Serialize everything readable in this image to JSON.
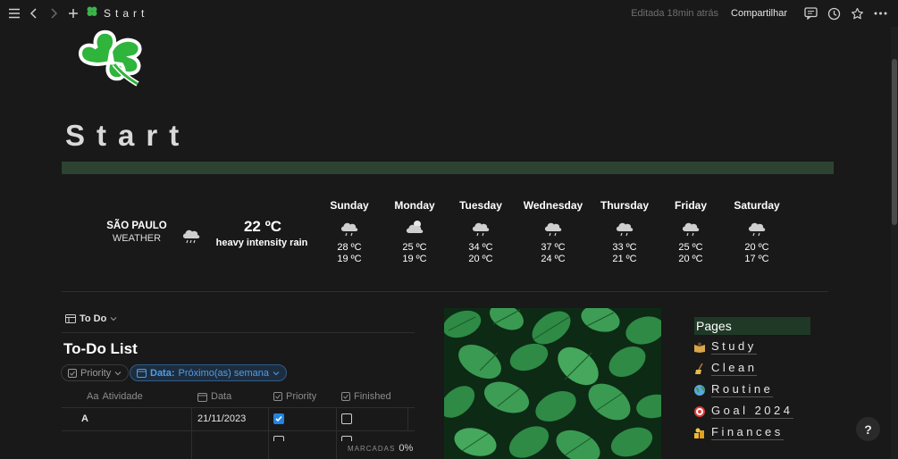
{
  "topbar": {
    "breadcrumb_title": "Start",
    "edited_text": "Editada 18min atrás",
    "share_label": "Compartilhar"
  },
  "page": {
    "title": "Start",
    "band_color": "#2c4331"
  },
  "weather": {
    "city": "SÃO PAULO",
    "subtitle": "WEATHER",
    "current_temp": "22 ºC",
    "current_desc": "heavy intensity rain",
    "current_icon": "rain-cloud-icon",
    "days": [
      {
        "name": "Sunday",
        "hi": "28 ºC",
        "lo": "19 ºC",
        "icon": "rain-cloud-icon"
      },
      {
        "name": "Monday",
        "hi": "25 ºC",
        "lo": "19 ºC",
        "icon": "sun-cloud-icon"
      },
      {
        "name": "Tuesday",
        "hi": "34 ºC",
        "lo": "20 ºC",
        "icon": "rain-cloud-icon"
      },
      {
        "name": "Wednesday",
        "hi": "37 ºC",
        "lo": "24 ºC",
        "icon": "rain-cloud-icon"
      },
      {
        "name": "Thursday",
        "hi": "33 ºC",
        "lo": "21 ºC",
        "icon": "rain-cloud-icon"
      },
      {
        "name": "Friday",
        "hi": "25 ºC",
        "lo": "20 ºC",
        "icon": "rain-cloud-icon"
      },
      {
        "name": "Saturday",
        "hi": "20 ºC",
        "lo": "17 ºC",
        "icon": "rain-cloud-icon"
      }
    ]
  },
  "todo": {
    "view_label": "To Do",
    "title": "To-Do List",
    "filter_priority": "Priority",
    "filter_date_key": "Data:",
    "filter_date_value": "Próximo(as) semana",
    "columns": {
      "activity": "Atividade",
      "date": "Data",
      "priority": "Priority",
      "finished": "Finished"
    },
    "rows": [
      {
        "activity": "A",
        "date": "21/11/2023",
        "priority": true,
        "finished": false
      }
    ],
    "footer_label": "MARCADAS",
    "footer_value": "0%"
  },
  "pages": {
    "heading": "Pages",
    "items": [
      {
        "label": "Study",
        "icon": "reading-icon"
      },
      {
        "label": "Clean",
        "icon": "broom-icon"
      },
      {
        "label": "Routine",
        "icon": "globe-icon"
      },
      {
        "label": "Goal 2024",
        "icon": "target-icon"
      },
      {
        "label": "Finances",
        "icon": "coins-icon"
      }
    ]
  },
  "help_label": "?"
}
